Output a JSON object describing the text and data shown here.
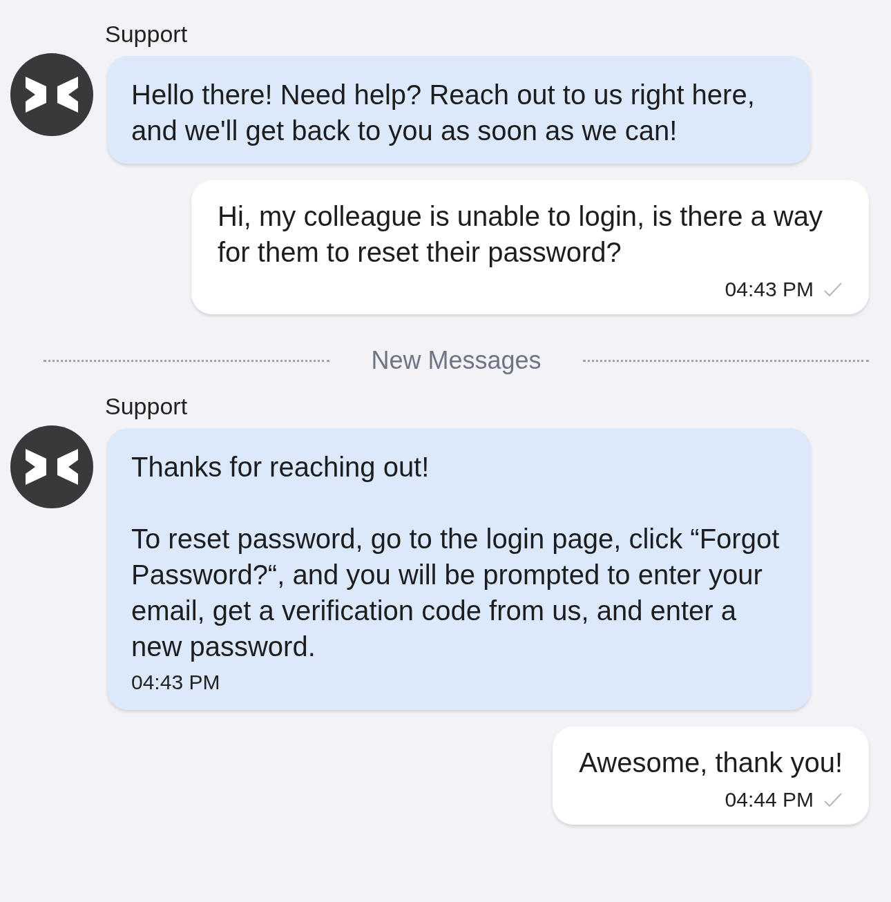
{
  "messages": [
    {
      "kind": "incoming",
      "sender": "Support",
      "text": "Hello there! Need help? Reach out to us right here, and we'll get back to you as soon as we can!"
    },
    {
      "kind": "outgoing",
      "text": "Hi, my colleague is unable to login, is there a way for them to reset their password?",
      "time": "04:43 PM"
    },
    {
      "kind": "divider",
      "text": "New Messages"
    },
    {
      "kind": "incoming",
      "sender": "Support",
      "text": "Thanks for reaching out!\n\nTo reset password, go to the login page, click “Forgot Password?“, and you will be prompted to enter your email, get a verification code from us, and enter a new password.",
      "time": "04:43 PM"
    },
    {
      "kind": "outgoing",
      "text": "Awesome, thank you!",
      "time": "04:44 PM"
    }
  ]
}
